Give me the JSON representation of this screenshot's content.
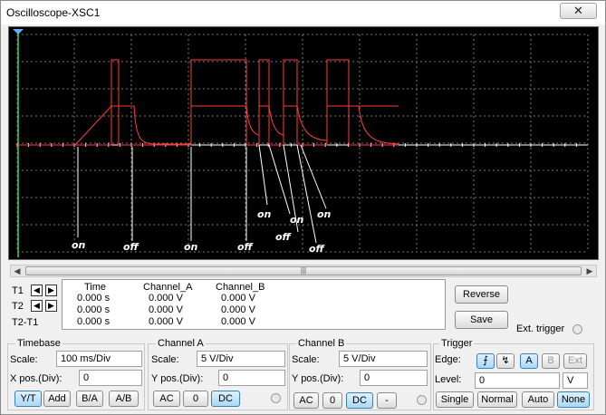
{
  "window": {
    "title": "Oscilloscope-XSC1",
    "close_glyph": "✕"
  },
  "screen": {
    "background": "#000000",
    "trace_color": "#ff3c3c",
    "axis_color": "#ffffff",
    "grid_color": "#777777",
    "markers": [
      "on",
      "off",
      "on",
      "off",
      "on",
      "off",
      "on",
      "off",
      "on"
    ]
  },
  "readout": {
    "headers": {
      "time": "Time",
      "channel_a": "Channel_A",
      "channel_b": "Channel_B"
    },
    "rows": [
      {
        "label": "T1",
        "time": "0.000 s",
        "a": "0.000 V",
        "b": "0.000 V"
      },
      {
        "label": "T2",
        "time": "0.000 s",
        "a": "0.000 V",
        "b": "0.000 V"
      },
      {
        "label": "T2-T1",
        "time": "0.000 s",
        "a": "0.000 V",
        "b": "0.000 V"
      }
    ],
    "reverse_label": "Reverse",
    "save_label": "Save",
    "ext_trigger_label": "Ext. trigger"
  },
  "timebase": {
    "title": "Timebase",
    "scale_label": "Scale:",
    "scale_value": "100 ms/Div",
    "xpos_label": "X pos.(Div):",
    "xpos_value": "0",
    "modes": [
      "Y/T",
      "Add",
      "B/A",
      "A/B"
    ]
  },
  "channel_a": {
    "title": "Channel A",
    "scale_label": "Scale:",
    "scale_value": "5  V/Div",
    "ypos_label": "Y pos.(Div):",
    "ypos_value": "0",
    "coupling": [
      "AC",
      "0",
      "DC"
    ]
  },
  "channel_b": {
    "title": "Channel B",
    "scale_label": "Scale:",
    "scale_value": "5  V/Div",
    "ypos_label": "Y pos.(Div):",
    "ypos_value": "0",
    "coupling": [
      "AC",
      "0",
      "DC",
      "-"
    ]
  },
  "trigger": {
    "title": "Trigger",
    "edge_label": "Edge:",
    "edge_rise": "⨍",
    "edge_fall": "↯",
    "sources": [
      "A",
      "B",
      "Ext"
    ],
    "level_label": "Level:",
    "level_value": "0",
    "level_unit": "V",
    "modes": [
      "Single",
      "Normal",
      "Auto",
      "None"
    ]
  }
}
